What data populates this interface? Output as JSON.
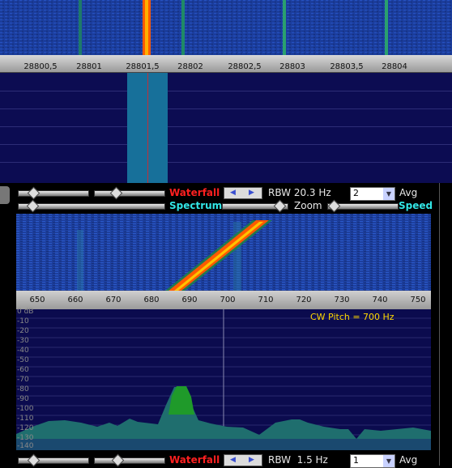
{
  "top_axis": {
    "labels": [
      "28800,5",
      "28801",
      "28801,5",
      "28802",
      "28802,5",
      "28803",
      "28803,5",
      "28804"
    ]
  },
  "controls": {
    "waterfall_label": "Waterfall",
    "spectrum_label": "Spectrum",
    "zoom_label": "Zoom",
    "speed_label": "Speed",
    "rbw_top": "RBW 20.3 Hz",
    "avg_value_top": "2",
    "avg_label_top": "Avg",
    "rbw_bottom": "RBW  1.5 Hz",
    "avg_value_bottom": "1",
    "avg_label_bottom": "Avg"
  },
  "audio_axis": {
    "labels": [
      "650",
      "660",
      "670",
      "680",
      "690",
      "700",
      "710",
      "720",
      "730",
      "740",
      "750"
    ]
  },
  "audio_spectrum": {
    "cw_pitch": "CW Pitch = 700 Hz",
    "db_labels": [
      "0 dB",
      "-10",
      "-20",
      "-30",
      "-40",
      "-50",
      "-60",
      "-70",
      "-80",
      "-90",
      "-100",
      "-110",
      "-120",
      "-130",
      "-140"
    ]
  },
  "colors": {
    "waterfall_bg": "#1b3d9c",
    "signal": "#ff6a00",
    "spectrum_fill": "#1f6e6e",
    "signal_peak": "#1f9a2a"
  }
}
